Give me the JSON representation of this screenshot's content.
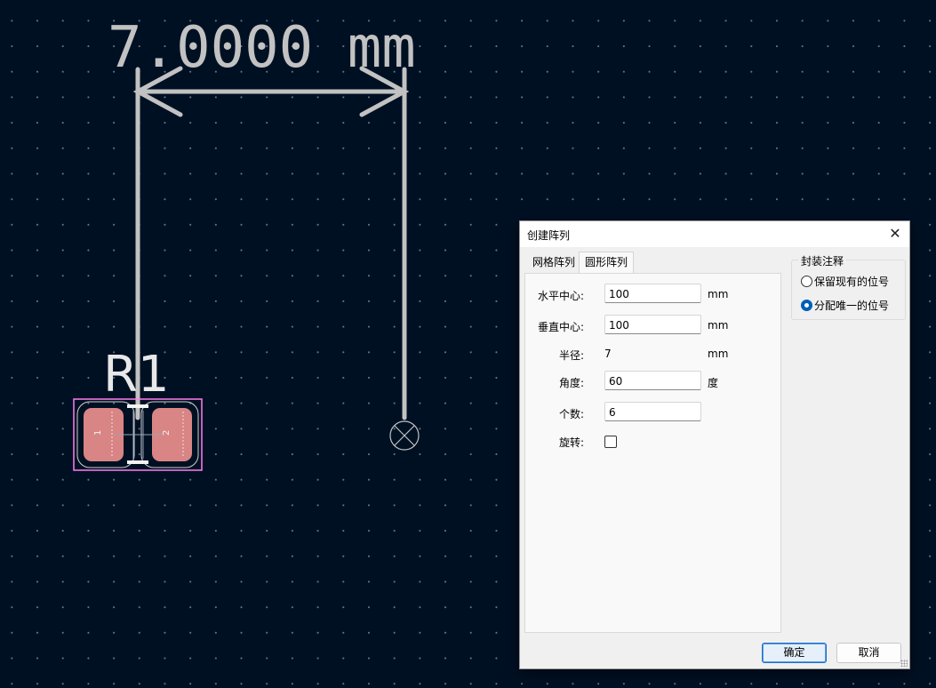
{
  "canvas": {
    "dimension_text": "7.0000 mm",
    "ref_text": "R1",
    "pad1": "1",
    "pad2": "2"
  },
  "dialog": {
    "title": "创建阵列",
    "tabs": [
      {
        "label": "网格阵列",
        "active": false
      },
      {
        "label": "圆形阵列",
        "active": true
      }
    ],
    "fields": {
      "h_center": {
        "label": "水平中心:",
        "value": "100",
        "unit": "mm"
      },
      "v_center": {
        "label": "垂直中心:",
        "value": "100",
        "unit": "mm"
      },
      "radius": {
        "label": "半径:",
        "value": "7",
        "unit": "mm"
      },
      "angle": {
        "label": "角度:",
        "value": "60",
        "unit": "度"
      },
      "count": {
        "label": "个数:",
        "value": "6"
      },
      "rotate": {
        "label": "旋转:",
        "checked": false
      }
    },
    "annotation_group": {
      "title": "封装注释",
      "options": [
        {
          "label": "保留现有的位号",
          "selected": false
        },
        {
          "label": "分配唯一的位号",
          "selected": true
        }
      ]
    },
    "ok_label": "确定",
    "cancel_label": "取消"
  },
  "colors": {
    "canvas_bg": "#001023",
    "dimension": "#c2c2c2",
    "pad": "#d98585",
    "courtyard": "#ff7ff0",
    "accent": "#005fb8"
  }
}
